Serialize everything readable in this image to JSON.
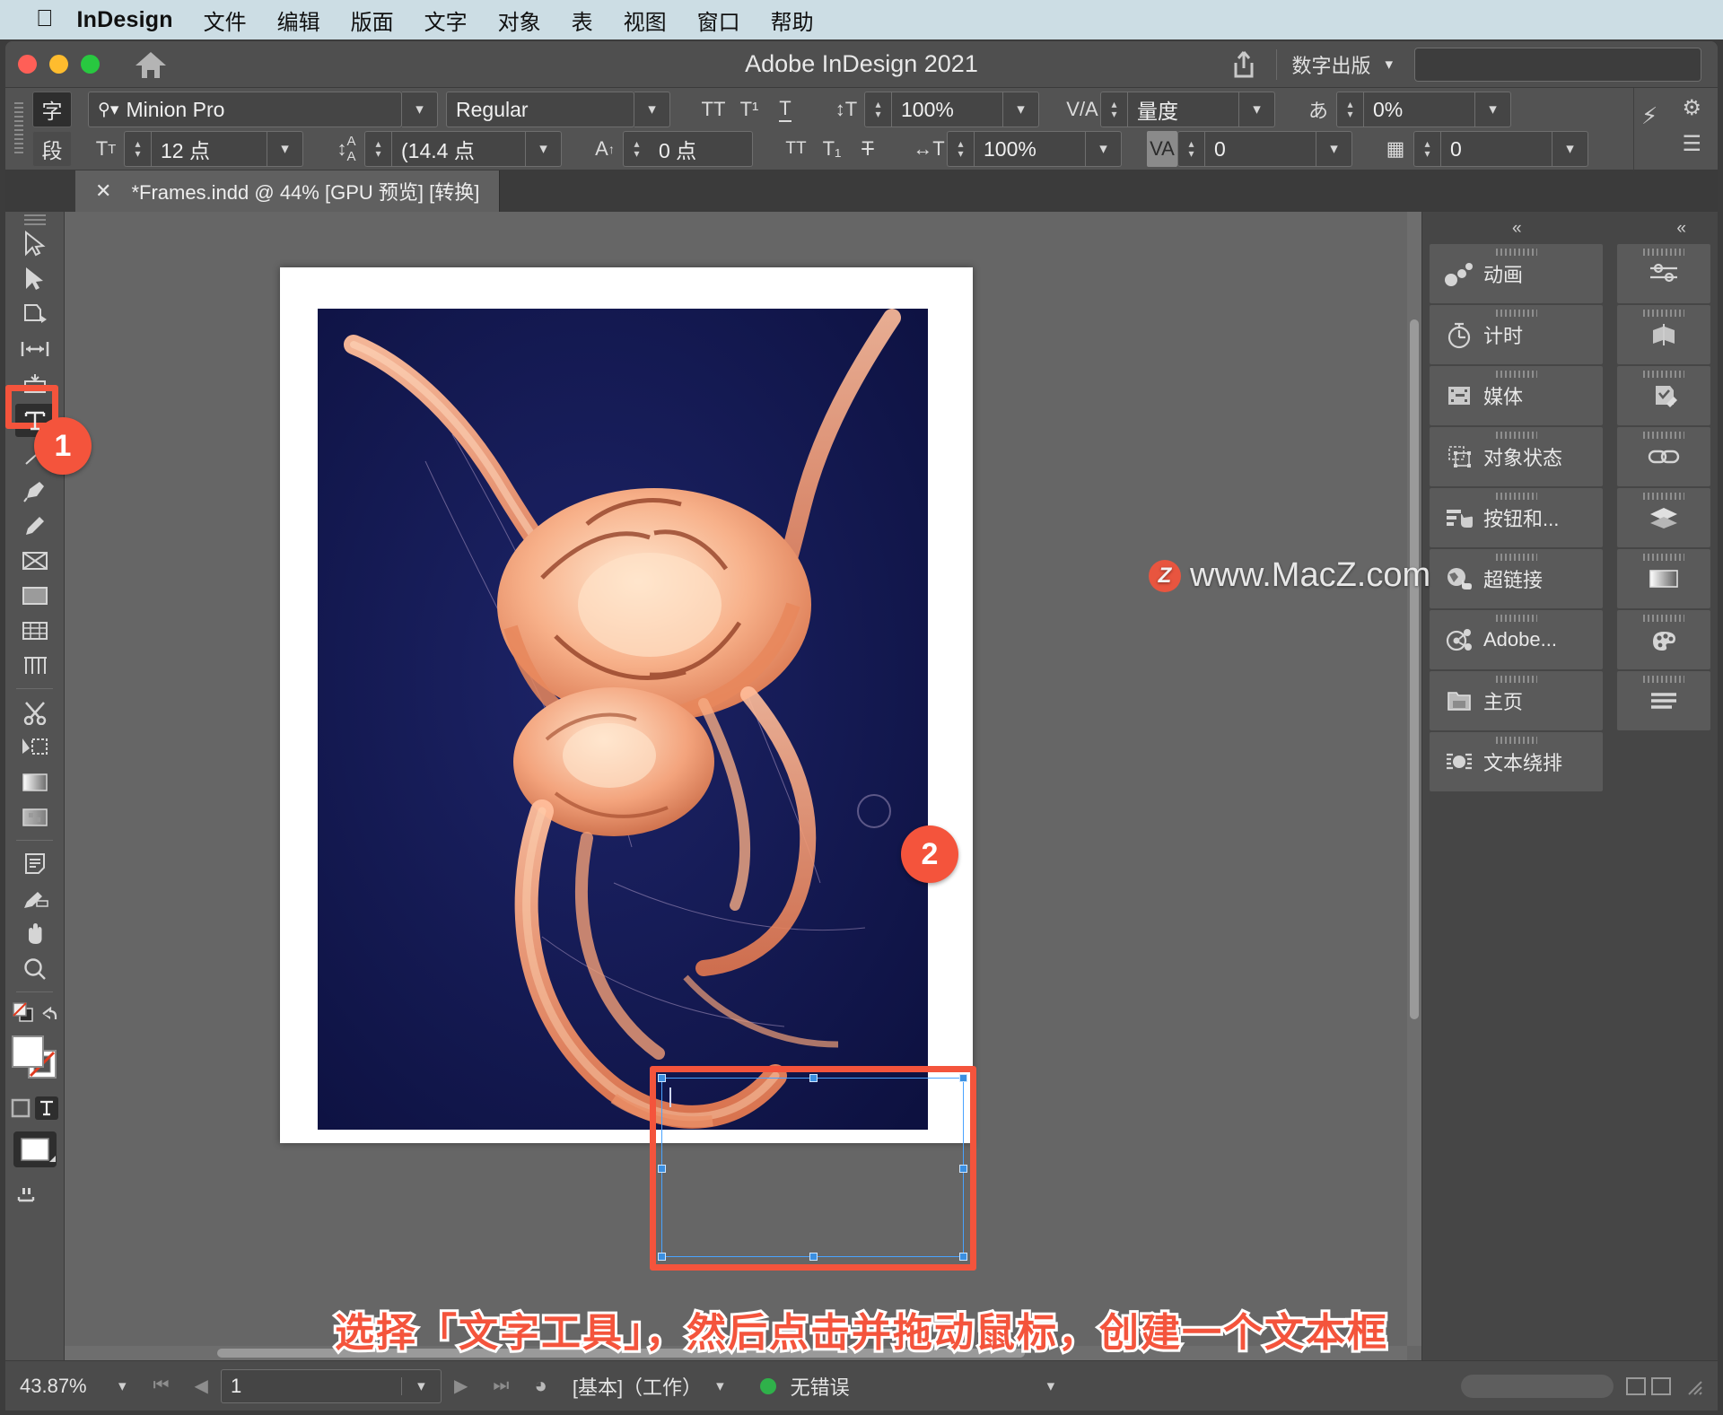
{
  "menubar": {
    "apple_icon": "apple-icon",
    "brand": "InDesign",
    "items": [
      "文件",
      "编辑",
      "版面",
      "文字",
      "对象",
      "表",
      "视图",
      "窗口",
      "帮助"
    ]
  },
  "titlebar": {
    "title": "Adobe InDesign 2021",
    "home_icon": "home-icon",
    "share_icon": "share-icon",
    "workspace": "数字出版",
    "search_placeholder": ""
  },
  "control_panel": {
    "mode_char": "字",
    "mode_para": "段",
    "font_family": "Minion Pro",
    "font_style": "Regular",
    "font_size": "12 点",
    "leading": "(14.4 点",
    "baseline_shift": "0 点",
    "vertical_scale": "100%",
    "horizontal_scale": "100%",
    "kerning": "量度",
    "tracking": "0",
    "tsume": "0%",
    "grid_spacing": "0",
    "buttons": {
      "all_caps": "TT",
      "superscript": "T¹",
      "underline": "T",
      "small_caps": "TT",
      "subscript": "T₁",
      "strikethrough": "T"
    }
  },
  "document_tab": {
    "close_icon": "close-icon",
    "label": "*Frames.indd @ 44% [GPU 预览] [转换]"
  },
  "tools": [
    {
      "name": "selection-tool",
      "icon": "arrow-pointer"
    },
    {
      "name": "direct-selection-tool",
      "icon": "arrow-solid"
    },
    {
      "name": "page-tool",
      "icon": "page"
    },
    {
      "name": "gap-tool",
      "icon": "gap"
    },
    {
      "name": "content-collector-tool",
      "icon": "collector"
    },
    {
      "name": "type-tool",
      "icon": "type-T",
      "selected": true
    },
    {
      "name": "line-tool",
      "icon": "line"
    },
    {
      "name": "pen-tool",
      "icon": "pen"
    },
    {
      "name": "pencil-tool",
      "icon": "pencil"
    },
    {
      "name": "frame-tool",
      "icon": "frame-x"
    },
    {
      "name": "rectangle-tool",
      "icon": "rectangle"
    },
    {
      "name": "free-transform-tool",
      "icon": "transform"
    },
    {
      "name": "scale-tool",
      "icon": "scale"
    },
    {
      "name": "scissors-tool",
      "icon": "scissors"
    },
    {
      "name": "transform-again-tool",
      "icon": "transform2"
    },
    {
      "name": "gradient-swatch-tool",
      "icon": "gradient"
    },
    {
      "name": "gradient-feather-tool",
      "icon": "feather"
    },
    {
      "name": "note-tool",
      "icon": "note"
    },
    {
      "name": "eyedropper-tool",
      "icon": "eyedropper"
    },
    {
      "name": "hand-tool",
      "icon": "hand"
    },
    {
      "name": "zoom-tool",
      "icon": "magnifier"
    }
  ],
  "dock": {
    "wide_items": [
      {
        "label": "动画",
        "icon": "animation-icon"
      },
      {
        "label": "计时",
        "icon": "timing-icon"
      },
      {
        "label": "媒体",
        "icon": "media-icon"
      },
      {
        "label": "对象状态",
        "icon": "object-states-icon"
      },
      {
        "label": "按钮和...",
        "icon": "buttons-forms-icon"
      },
      {
        "label": "超链接",
        "icon": "hyperlinks-icon"
      },
      {
        "label": "Adobe...",
        "icon": "adobe-color-icon"
      },
      {
        "label": "主页",
        "icon": "pages-icon"
      },
      {
        "label": "文本绕排",
        "icon": "text-wrap-icon"
      }
    ],
    "narrow_items": [
      {
        "icon": "properties-icon"
      },
      {
        "icon": "pages-spread-icon"
      },
      {
        "icon": "preflight-icon"
      },
      {
        "icon": "links-icon"
      },
      {
        "icon": "layers-icon"
      },
      {
        "icon": "gradient-panel-icon"
      },
      {
        "icon": "swatches-icon"
      },
      {
        "icon": "paragraph-styles-icon"
      }
    ],
    "collapse_left": "«",
    "collapse_right": "«"
  },
  "callouts": [
    {
      "number": "1",
      "target": "type-tool"
    },
    {
      "number": "2",
      "target": "text-frame"
    }
  ],
  "caption": "选择「文字工具」，然后点击并拖动鼠标，创建一个文本框",
  "watermark": {
    "logo": "Z",
    "text": "www.MacZ.com"
  },
  "status_bar": {
    "zoom": "43.87%",
    "page": "1",
    "first_icon": "first-page-icon",
    "prev_icon": "prev-page-icon",
    "next_icon": "next-page-icon",
    "last_icon": "last-page-icon",
    "master_icon": "page-jump-icon",
    "workspace": "[基本]（工作）",
    "status_dot_color": "#2fb14a",
    "status_text": "无错误"
  },
  "colors": {
    "accent_red": "#f4543c",
    "menubar_bg": "#ccdde4",
    "window_bg": "#535353",
    "canvas_bg": "#666666",
    "selection_blue": "#49a3ff",
    "photo_bg": "#151a4e"
  }
}
